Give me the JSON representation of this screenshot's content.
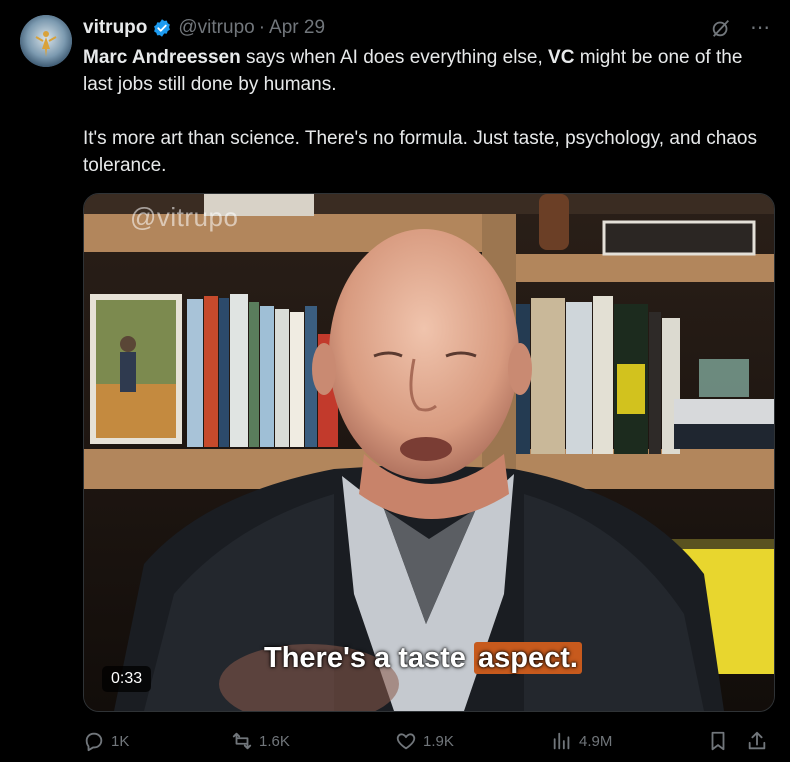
{
  "tweet": {
    "author_name": "vitrupo",
    "handle": "@vitrupo",
    "separator": "·",
    "date": "Apr 29",
    "text_p1_name": "Marc Andreessen",
    "text_p1_mid": " says when AI does everything else, ",
    "text_p1_vc": "VC",
    "text_p1_end": " might be one of the last jobs still done by humans.",
    "text_p2": "It's more art than science. There's no formula. Just taste, psychology, and chaos tolerance."
  },
  "video": {
    "watermark": "@vitrupo",
    "caption_plain": "There's a taste ",
    "caption_highlight": "aspect.",
    "duration": "0:33"
  },
  "actions": {
    "replies": "1K",
    "reposts": "1.6K",
    "likes": "1.9K",
    "views": "4.9M"
  },
  "colors": {
    "background": "#000000",
    "text": "#e7e9ea",
    "muted": "#71767b",
    "verified": "#1d9bf0",
    "caption_highlight": "#c75a1d"
  }
}
